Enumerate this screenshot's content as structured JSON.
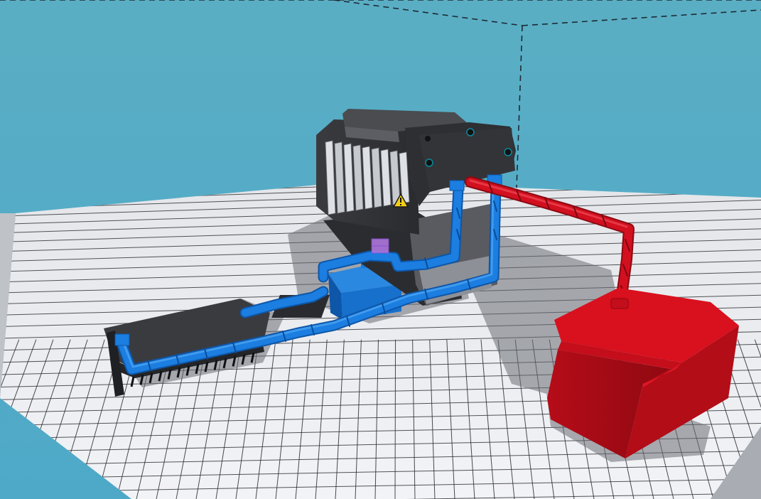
{
  "colors": {
    "sky_top": "#5aaec4",
    "sky_bottom": "#4aa9cc",
    "baseplate_top": "#eef0f4",
    "baseplate_grid": "#2a2c30",
    "baseplate_side": "#9fa2a8",
    "engine_dark": "#2c2d30",
    "engine_mid": "#45474b",
    "engine_light": "#cfd2d6",
    "coolant_blue": "#1877d6",
    "coolant_blue_dark": "#0e56a8",
    "fuel_red": "#d21020",
    "fuel_red_dark": "#9a0a15",
    "tank_red": "#d9101e",
    "warning_yellow": "#f3cf12",
    "selection_purple": "#b57be8",
    "radiator_dark": "#2e2f33"
  },
  "icons": {
    "warning": "warning-icon"
  },
  "objects": [
    "engine-block",
    "coolant-pipes",
    "fuel-line",
    "fuel-tank",
    "radiator",
    "coolant-pump",
    "selection-handle",
    "baseplate",
    "boundary-box"
  ]
}
